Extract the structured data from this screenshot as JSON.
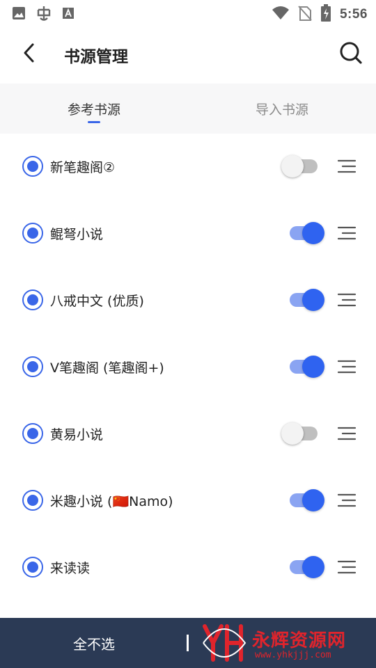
{
  "status_bar": {
    "time": "5:56",
    "left_icons": [
      "image-icon",
      "bug-icon",
      "text-a-icon"
    ],
    "right_icons": [
      "wifi-icon",
      "no-sim-icon",
      "battery-charging-icon"
    ]
  },
  "header": {
    "back_icon": "chevron-left-icon",
    "title": "书源管理",
    "search_icon": "search-icon"
  },
  "tabs": [
    {
      "label": "参考书源",
      "active": true
    },
    {
      "label": "导入书源",
      "active": false
    }
  ],
  "sources": [
    {
      "name": "新笔趣阁②",
      "selected": true,
      "enabled": false
    },
    {
      "name": "鲲弩小说",
      "selected": true,
      "enabled": true
    },
    {
      "name": "八戒中文 (优质)",
      "selected": true,
      "enabled": true
    },
    {
      "name": "V笔趣阁 (笔趣阁+)",
      "selected": true,
      "enabled": true
    },
    {
      "name": "黄易小说",
      "selected": true,
      "enabled": false
    },
    {
      "name": "米趣小说 (🇨🇳Namo)",
      "selected": true,
      "enabled": true
    },
    {
      "name": "来读读",
      "selected": true,
      "enabled": true
    }
  ],
  "bottom_bar": {
    "deselect_all_label": "全不选"
  },
  "watermark": {
    "text": "永辉资源网",
    "url": "www.yhkjjj.com"
  },
  "colors": {
    "accent": "#3a66e8",
    "switch_on": "#2f63f0",
    "bottom_bar": "#2b3a55",
    "watermark": "#e0242c"
  }
}
